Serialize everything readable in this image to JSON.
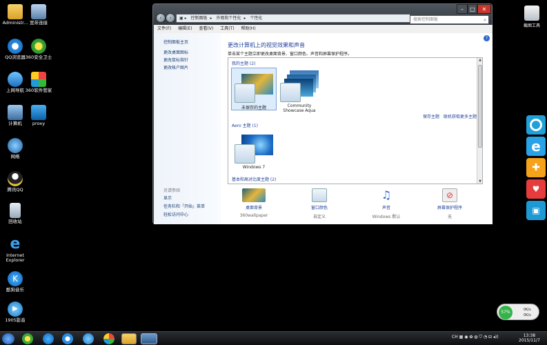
{
  "desktop": {
    "icons": [
      {
        "label": "Administr..."
      },
      {
        "label": "宽带连接"
      },
      {
        "label": "QQ浏览器"
      },
      {
        "label": "360安全卫士"
      },
      {
        "label": "上网导航"
      },
      {
        "label": "360软件管家"
      },
      {
        "label": "计算机"
      },
      {
        "label": "proxy"
      },
      {
        "label": "网络"
      },
      {
        "label": "腾讯QQ"
      },
      {
        "label": "回收站"
      },
      {
        "label": "Internet Explorer"
      },
      {
        "label": "酷狗音乐"
      },
      {
        "label": "1905影音"
      }
    ],
    "tool_label": "截图工具"
  },
  "window": {
    "breadcrumb": [
      "控制面板",
      "外观和个性化",
      "个性化"
    ],
    "search_placeholder": "搜索控制面板",
    "menu": [
      "文件(F)",
      "编辑(E)",
      "查看(V)",
      "工具(T)",
      "帮助(H)"
    ],
    "left_nav": {
      "home": "控制面板主页",
      "items": [
        "更改桌面图标",
        "更改鼠标指针",
        "更改帐户图片"
      ],
      "see_also_title": "另请参阅",
      "see_also": [
        "显示",
        "任务栏和「开始」菜单",
        "轻松访问中心"
      ]
    },
    "heading": "更改计算机上的视觉效果和声音",
    "subheading": "单击某个主题立即更改桌面背景、窗口颜色、声音和屏幕保护程序。",
    "my_themes_title": "我的主题 (2)",
    "my_themes": [
      {
        "name": "未保存的主题"
      },
      {
        "name": "Community Showcase Aqua"
      }
    ],
    "save_theme_link": "保存主题",
    "online_link": "联机获取更多主题",
    "aero_title": "Aero 主题 (1)",
    "aero_themes": [
      {
        "name": "Windows 7"
      }
    ],
    "basic_title": "基本和高对比度主题 (2)",
    "bottom": [
      {
        "label": "桌面背景",
        "value": "360wallpaper"
      },
      {
        "label": "窗口颜色",
        "value": "自定义"
      },
      {
        "label": "声音",
        "value": "Windows 默认"
      },
      {
        "label": "屏幕保护程序",
        "value": "无"
      }
    ]
  },
  "taskbar": {
    "tray_text": "CH",
    "time": "13:38",
    "date": "2015/11/7"
  },
  "net_meter": {
    "percent": "57%",
    "up": "0K/s",
    "down": "0K/s"
  }
}
